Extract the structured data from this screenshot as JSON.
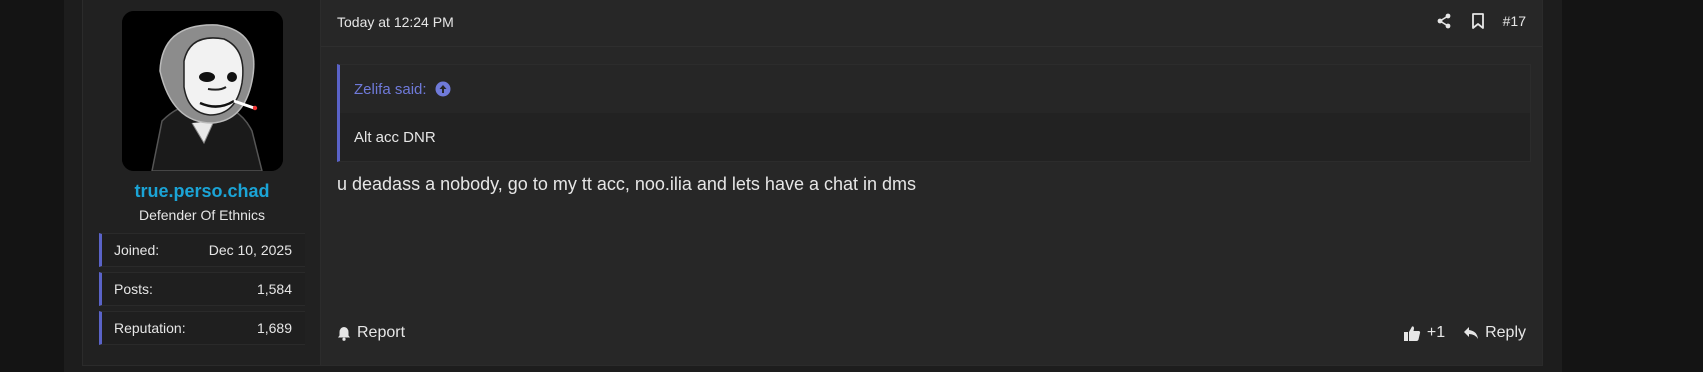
{
  "user": {
    "username": "true.perso.chad",
    "title": "Defender Of Ethnics",
    "stats": [
      {
        "label": "Joined:",
        "value": "Dec 10, 2025"
      },
      {
        "label": "Posts:",
        "value": "1,584"
      },
      {
        "label": "Reputation:",
        "value": "1,689"
      }
    ]
  },
  "post": {
    "date": "Today at 12:24 PM",
    "number": "#17",
    "quote": {
      "author": "Zelifa said:",
      "text": "Alt acc DNR"
    },
    "message": "u deadass a nobody, go to my tt acc, noo.ilia and lets have a chat in dms",
    "footer": {
      "report_label": "Report",
      "reaction_count": "+1",
      "reply_label": "Reply"
    }
  },
  "colors": {
    "accent": "#5a63c8",
    "username": "#1ba4d6",
    "quote_author": "#6f7ad9",
    "background": "#232323"
  },
  "icons": [
    "share-icon",
    "bookmark-icon",
    "arrow-up-circle-icon",
    "bell-icon",
    "thumbs-up-icon",
    "reply-icon"
  ]
}
